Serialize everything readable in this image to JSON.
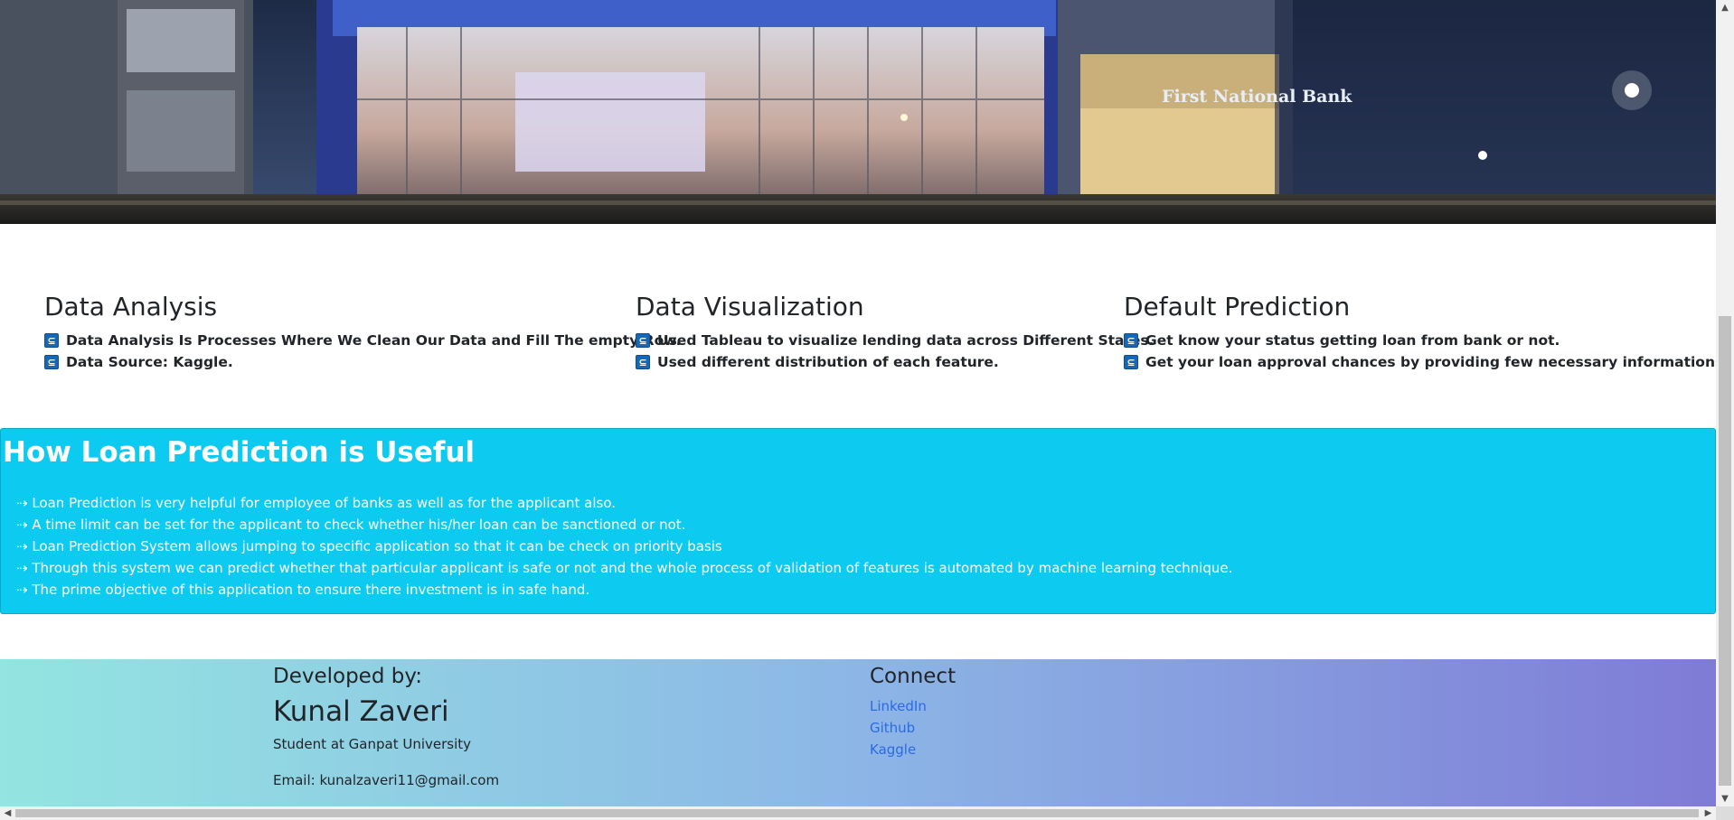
{
  "hero": {
    "building_sign": "First National Bank"
  },
  "features": [
    {
      "title": "Data Analysis",
      "items": [
        "Data Analysis Is Processes Where We Clean Our Data and Fill The empty Row.",
        "Data Source: Kaggle."
      ]
    },
    {
      "title": "Data Visualization",
      "items": [
        "Used Tableau to visualize lending data across Different States.",
        "Used different distribution of each feature."
      ]
    },
    {
      "title": "Default Prediction",
      "items": [
        "Get know your status getting loan from bank or not.",
        "Get your loan approval chances by providing few necessary informations."
      ]
    }
  ],
  "useful": {
    "title": "How Loan Prediction is Useful",
    "items": [
      "⇢ Loan Prediction is very helpful for employee of banks as well as for the applicant also.",
      "⇢ A time limit can be set for the applicant to check whether his/her loan can be sanctioned or not.",
      "⇢ Loan Prediction System allows jumping to specific application so that it can be check on priority basis",
      "⇢ Through this system we can predict whether that particular applicant is safe or not and the whole process of validation of features is automated by machine learning technique.",
      "⇢ The prime objective of this application to ensure there investment is in safe hand."
    ]
  },
  "footer": {
    "developed_by": "Developed by:",
    "name": "Kunal Zaveri",
    "subtitle": "Student at Ganpat University",
    "email": "Email: kunalzaveri11@gmail.com",
    "connect_title": "Connect",
    "links": [
      "LinkedIn",
      "Github",
      "Kaggle"
    ]
  },
  "colors": {
    "info": "#0dcaf0",
    "link": "#2a6ae8",
    "checkbox": "#1767b7"
  },
  "icons": {
    "list_marker": "checkbox-arrow-icon"
  }
}
